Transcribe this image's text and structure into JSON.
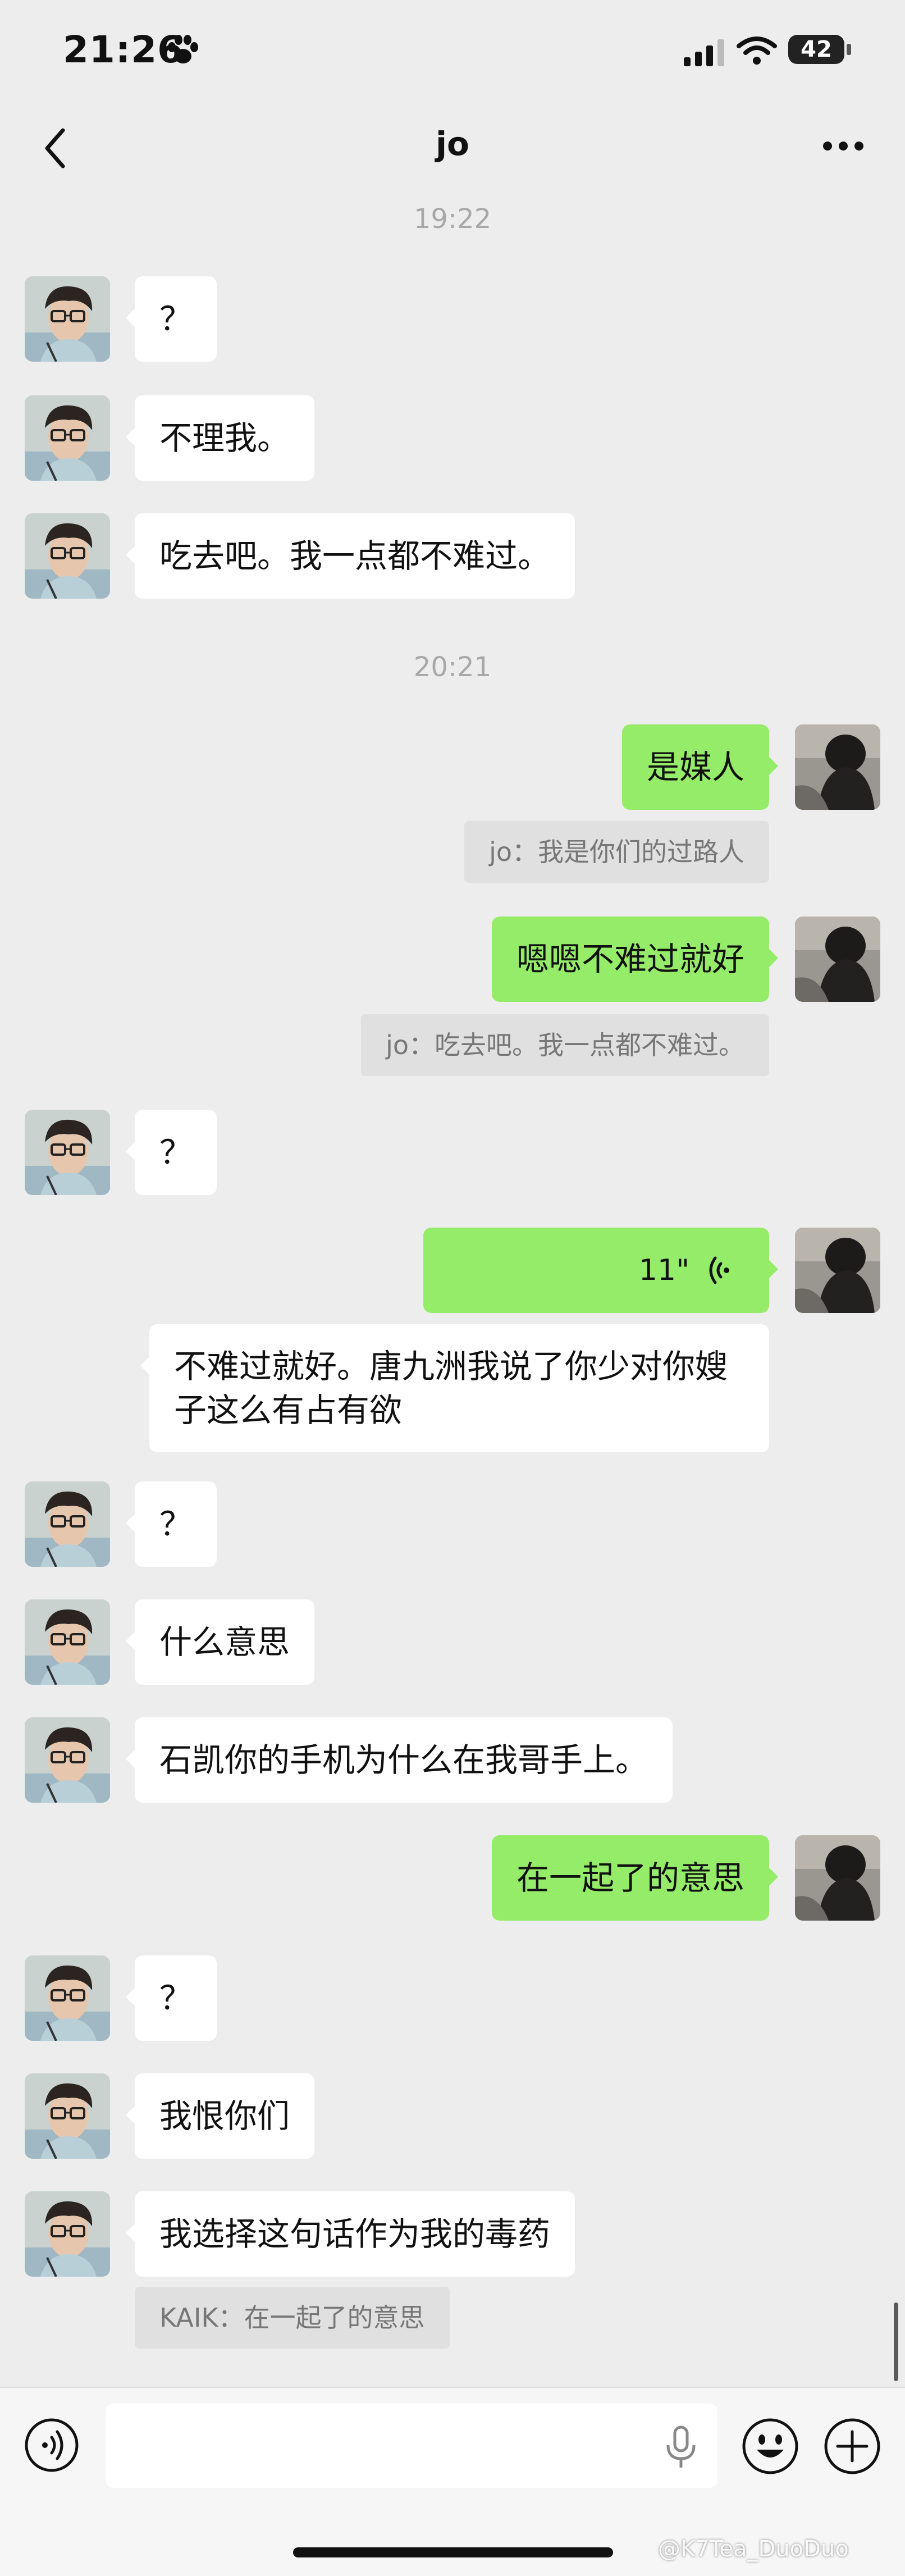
{
  "status_bar": {
    "time": "21:26",
    "battery": "42"
  },
  "header": {
    "title": "jo",
    "back_icon": "chevron-left-icon",
    "more_icon": "ellipsis-icon"
  },
  "chat": {
    "timestamps": [
      "19:22",
      "20:21"
    ],
    "messages": [
      {
        "side": "in",
        "text": "？"
      },
      {
        "side": "in",
        "text": "不理我。"
      },
      {
        "side": "in",
        "text": "吃去吧。我一点都不难过。"
      },
      {
        "side": "out",
        "text": "是媒人"
      },
      {
        "side": "out",
        "quote": "jo：我是你们的过路人"
      },
      {
        "side": "out",
        "text": "嗯嗯不难过就好"
      },
      {
        "side": "out",
        "quote": "jo：吃去吧。我一点都不难过。"
      },
      {
        "side": "in",
        "text": "？"
      },
      {
        "side": "out",
        "voice_duration": "11\""
      },
      {
        "side": "out",
        "text": "不难过就好。唐九洲我说了你少对你嫂子这么有占有欲"
      },
      {
        "side": "in",
        "text": "？"
      },
      {
        "side": "in",
        "text": "什么意思"
      },
      {
        "side": "in",
        "text": "石凯你的手机为什么在我哥手上。"
      },
      {
        "side": "out",
        "text": "在一起了的意思"
      },
      {
        "side": "in",
        "text": "？"
      },
      {
        "side": "in",
        "text": "我恨你们"
      },
      {
        "side": "in",
        "text": "我选择这句话作为我的毒药"
      },
      {
        "side": "in",
        "quote": "KAIK：在一起了的意思"
      }
    ]
  },
  "input_bar": {
    "placeholder": "",
    "icons": [
      "voice-toggle-icon",
      "microphone-icon",
      "emoji-icon",
      "plus-icon"
    ]
  },
  "watermark": "@K7Tea_DuoDuo",
  "colors": {
    "background": "#ededed",
    "incoming_bubble": "#ffffff",
    "outgoing_bubble": "#95ec69",
    "quote_bg": "#e0e0e0",
    "timestamp": "#a8a8a8"
  }
}
